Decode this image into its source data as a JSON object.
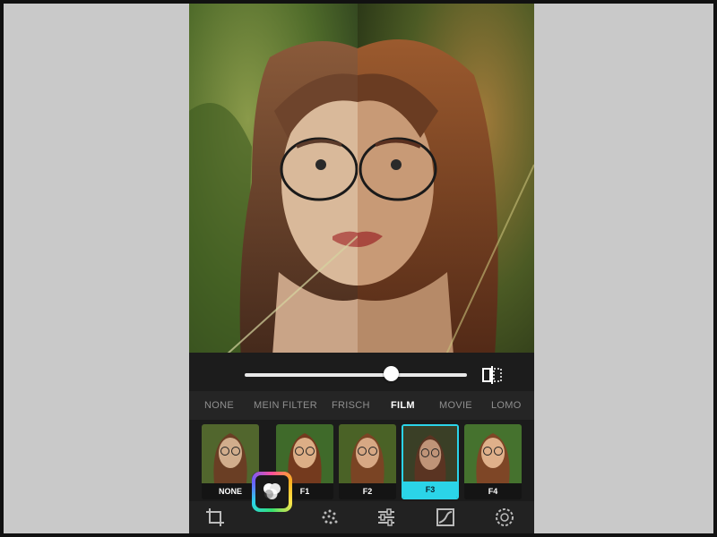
{
  "editor": {
    "intensity_slider_fraction": 0.66,
    "compare_icon": "split-compare-icon",
    "filter_tabs": [
      {
        "label": "NONE",
        "active": false
      },
      {
        "label": "MEIN FILTER",
        "active": false
      },
      {
        "label": "FRISCH",
        "active": false
      },
      {
        "label": "FILM",
        "active": true
      },
      {
        "label": "MOVIE",
        "active": false
      },
      {
        "label": "LOMO",
        "active": false
      }
    ],
    "filters": [
      {
        "label": "NONE",
        "selected": false
      },
      {
        "label": "F1",
        "selected": false
      },
      {
        "label": "F2",
        "selected": false
      },
      {
        "label": "F3",
        "selected": true
      },
      {
        "label": "F4",
        "selected": false
      }
    ],
    "toolbar_icons": [
      "crop-icon",
      "filters-icon",
      "effects-icon",
      "adjust-icon",
      "curves-icon",
      "vignette-icon"
    ],
    "colors": {
      "accent": "#2bd4e8",
      "background": "#161616"
    }
  }
}
